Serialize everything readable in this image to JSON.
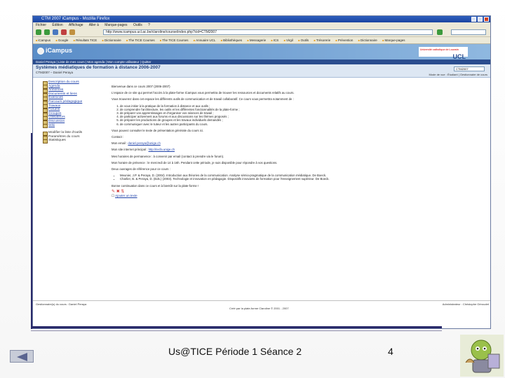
{
  "slide": {
    "footer_text": "Us@TICE Période 1 Séance 2",
    "page_number": "4"
  },
  "browser": {
    "window_title": "CTM 2007 iCampus - Mozilla Firefox",
    "menu": [
      "Fichier",
      "Édition",
      "Affichage",
      "Aller à",
      "Marque-pages",
      "Outils",
      "?"
    ],
    "url": "http://www.icampus.ucl.ac.be/claroline/course/index.php?cid=CTM2007",
    "bookmarks": [
      "iCampus",
      "Google",
      "Résultats TICE",
      "Dictionnaire",
      "The TICE Courses",
      "The TICE Courses",
      "Annuaire UCL",
      "Bibliothèques",
      "Messagerie",
      "ICS",
      "Virgil",
      "Outils",
      "Trésorerie",
      "Prévention",
      "Dictionnaire",
      "Marque-pages"
    ]
  },
  "icampus": {
    "logo": "iCampus",
    "ucl_small": "Université catholique de Louvain",
    "ucl": "UCL",
    "nav": "Daniel Peraya | Liste de mes cours | Mon agenda | Mon compte utilisateur | Quitter",
    "course_title": "Systèmes médiatiques de formation à distance 2006-2007",
    "course_sub": "CTM2007 – Daniel Peraya",
    "course_select": "CTM2007",
    "crumb_right": "Mode de vue : Étudiant | Gestionnaire de cours"
  },
  "sidebar": {
    "items": [
      {
        "label": "Description du cours",
        "link": true
      },
      {
        "label": "Agenda",
        "link": true
      },
      {
        "label": "Annonces",
        "link": true
      },
      {
        "label": "Documents et liens",
        "link": true
      },
      {
        "label": "Exercices",
        "link": true
      },
      {
        "label": "Parcours pédagogique",
        "link": true
      },
      {
        "label": "Travaux",
        "link": true
      },
      {
        "label": "Forums",
        "link": true
      },
      {
        "label": "Groupes",
        "link": true
      },
      {
        "label": "Utilisateurs",
        "link": true
      },
      {
        "label": "Discussion",
        "link": true
      },
      {
        "label": "Wiki",
        "link": true
      }
    ],
    "admin": [
      {
        "label": "Modifier la liste d'outils"
      },
      {
        "label": "Paramètres du cours"
      },
      {
        "label": "Statistiques"
      }
    ]
  },
  "main": {
    "welcome": "Bienvenue dans ce cours 2007 (2006-2007)",
    "intro": "L'espace de ce site qui permet l'accès à la plate-forme iCampus vous permettra de trouver les ressources et documents relatifs au cours.",
    "objectives_intro": "Vous trouverez dans cet espace les différents outils de communication et de travail collaboratif. Ce cours vous permettra notamment de :",
    "objectives": [
      "de vous initier à la pratique de la formation à distance et aux outils ;",
      "de comprendre l'architecture, les outils et les différentes fonctionnalités de la plate-forme ;",
      "de préparer vos apprentissages et d'organiser vos séances de travail ;",
      "de participer activement aux forums et aux discussions sur les thèmes proposés ;",
      "de préparer les productions de groupes et les travaux individuels demandés ;",
      "de communiquer avec le tuteur et les autres participants du cours."
    ],
    "link_text": "Vous pouvez consulter le texte de présentation générale du cours ici.",
    "contact_label": "Contact :",
    "email_label": "Mon email :",
    "email": "daniel.peraya@unige.ch",
    "site_label": "Mon site internet principal :",
    "site": "http://tecfa.unige.ch",
    "hours": "Mes horaires de permanence : à convenir par email (contact à prendre via le forum).",
    "session": "Mon horaire de présence : le mercredi de 14 à 16h. Pendant cette période, je suis disponible pour répondre à vos questions.",
    "refs_intro": "Deux ouvrages de référence pour ce cours :",
    "refs": [
      "Meunier, J.P. & Peraya, D. (2004). Introduction aux théories de la communication. Analyse sémio-pragmatique de la communication médiatique. De Boeck.",
      "Charlier, B. & Peraya, D. (Eds.) (2003). Technologie et innovation en pédagogie. Dispositifs innovants de formation pour l'enseignement supérieur. De Boeck."
    ],
    "closing": "Bonne continuation dans ce cours et à bientôt sur la plate-forme !",
    "add_link": "Ajouter un texte"
  },
  "page_footer": {
    "left": "Gestionnaire(s) du cours : Daniel Peraya",
    "right": "Administrateur : Christophe Géroudet",
    "center": "Créé par la plate-forme Claroline © 2001 - 2007"
  }
}
